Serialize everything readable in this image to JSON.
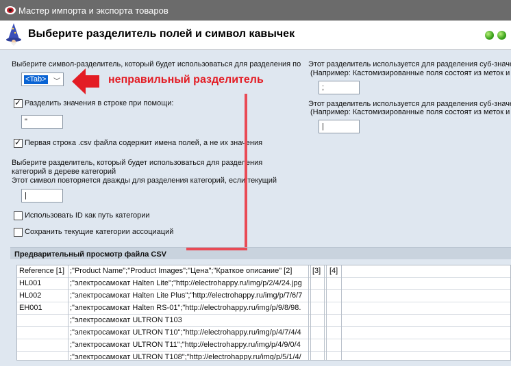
{
  "window": {
    "title": "Мастер импорта и экспорта товаров"
  },
  "header": {
    "title": "Выберите разделитель полей и символ кавычек"
  },
  "left": {
    "delimiter_label": "Выберите символ-разделитель, который будет использоваться для разделения по",
    "delimiter_value": "<Tab>",
    "split_values_label": "Разделить значения в строке при помощи:",
    "split_values_checked": true,
    "quote_value": "\"",
    "first_row_label": "Первая строка .csv файла содержит имена полей, а не их значения",
    "first_row_checked": true,
    "category_sep_line1": "Выберите разделитель, который будет использоваться для разделения",
    "category_sep_line2": "категорий в дереве категорий",
    "category_sep_line3": "Этот символ повторяется дважды для разделения категорий, если текущий",
    "category_sep_value": "|",
    "use_id_label": "Использовать ID как путь категории",
    "use_id_checked": false,
    "keep_assoc_label": "Сохранить текущие категории ассоциаций",
    "keep_assoc_checked": false
  },
  "right": {
    "sub_label1": "Этот разделитель используется для разделения суб-значе",
    "sub_example1": "(Например: Кастомизированные поля состоят из меток и т",
    "sub_value1": ";",
    "sub_label2": "Этот разделитель используется для разделения суб-значе",
    "sub_example2": "(Например: Кастомизированные поля состоят из меток и т",
    "sub_value2": "|"
  },
  "annotation": {
    "text": "неправильный разделитель",
    "color": "#e31c24"
  },
  "preview": {
    "title": "Предварительный просмотр файла CSV",
    "columns": [
      "Reference [1]",
      ";\"Product Name\";\"Product Images\";\"Цена\";\"Краткое описание\" [2]",
      "[3]",
      "[4]"
    ],
    "rows": [
      [
        "HL001",
        ";\"электросамокат Halten Lite\";\"http://electrohappy.ru/img/p/2/4/24.jpg",
        "",
        ""
      ],
      [
        "HL002",
        ";\"электросамокат Halten Lite Plus\";\"http://electrohappy.ru/img/p/7/6/7",
        "",
        ""
      ],
      [
        "EH001",
        ";\"электросамокат Halten RS-01\";\"http://electrohappy.ru/img/p/9/8/98.",
        "",
        ""
      ],
      [
        "",
        ";\"электросамокат ULTRON T103",
        "",
        ""
      ],
      [
        "",
        ";\"электросамокат ULTRON T10\";\"http://electrohappy.ru/img/p/4/7/4/4",
        "",
        ""
      ],
      [
        "",
        ";\"электросамокат ULTRON T11\";\"http://electrohappy.ru/img/p/4/9/0/4",
        "",
        ""
      ],
      [
        "",
        ";\"электросамокат ULTRON T108\";\"http://electrohappy.ru/img/p/5/1/4/",
        "",
        ""
      ]
    ]
  }
}
